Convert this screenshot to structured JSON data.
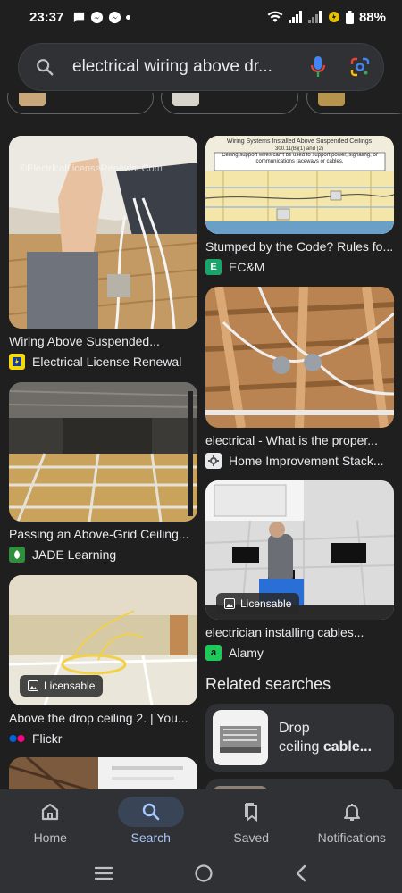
{
  "status": {
    "time": "23:37",
    "battery": "88%"
  },
  "search": {
    "query": "electrical wiring above dr..."
  },
  "results_left": [
    {
      "caption": "Wiring Above Suspended...",
      "source": "Electrical License Renewal",
      "watermark": "©ElectricalLicenseRenewal.Com"
    },
    {
      "caption": "Passing an Above-Grid Ceiling...",
      "source": "JADE Learning"
    },
    {
      "caption": "Above the drop ceiling 2. | You...",
      "source": "Flickr",
      "badge": "Licensable"
    }
  ],
  "results_right": [
    {
      "caption": "Stumped by the Code? Rules fo...",
      "source": "EC&M",
      "diagram_title": "Wiring Systems Installed Above Suspended Ceilings",
      "diagram_ref": "300.11(B)(1) and (2)",
      "diagram_note": "Ceiling support wires can't be used to support power, signaling, or communications raceways or cables."
    },
    {
      "caption": "electrical - What is the proper...",
      "source": "Home Improvement Stack..."
    },
    {
      "caption": "electrician installing cables...",
      "source": "Alamy",
      "badge": "Licensable"
    }
  ],
  "related": {
    "title": "Related searches",
    "item_line1": "Drop",
    "item_line2_prefix": "ceiling ",
    "item_line2_bold": "cable..."
  },
  "favicons": {
    "ecm": "E",
    "alamy": "a"
  },
  "nav": [
    {
      "label": "Home"
    },
    {
      "label": "Search"
    },
    {
      "label": "Saved"
    },
    {
      "label": "Notifications"
    }
  ],
  "colors": {
    "background": "#1f1f1f",
    "surface": "#303134",
    "active_nav": "#a8c7fa"
  }
}
